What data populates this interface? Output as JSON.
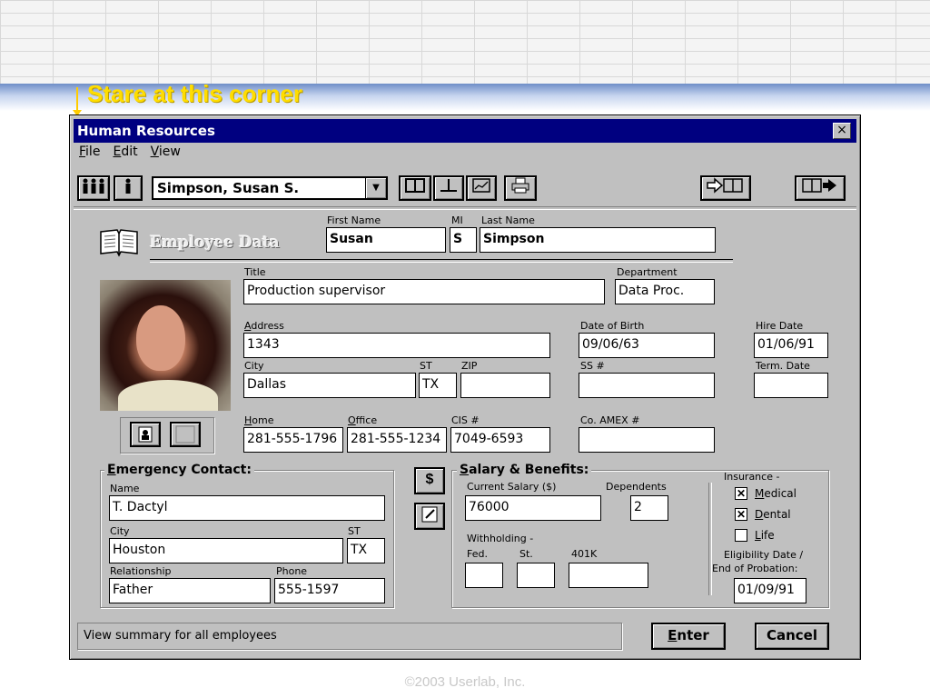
{
  "slide": {
    "note": "Stare at this corner",
    "footer": "©2003 Userlab, Inc."
  },
  "window": {
    "title": "Human Resources",
    "close_glyph": "×"
  },
  "menu": [
    "File",
    "Edit",
    "View"
  ],
  "toolbar": {
    "employee_select": "Simpson, Susan S."
  },
  "header": {
    "title": "Employee Data"
  },
  "employee": {
    "first_name_label": "First Name",
    "first_name": "Susan",
    "mi_label": "MI",
    "mi": "S",
    "last_name_label": "Last Name",
    "last_name": "Simpson",
    "title_label": "Title",
    "title": "Production supervisor",
    "department_label": "Department",
    "department": "Data Proc.",
    "address_label": "Address",
    "address": "1343",
    "dob_label": "Date of Birth",
    "dob": "09/06/63",
    "hire_date_label": "Hire Date",
    "hire_date": "01/06/91",
    "city_label": "City",
    "city": "Dallas",
    "st_label": "ST",
    "st": "TX",
    "zip_label": "ZIP",
    "zip": "",
    "ss_label": "SS #",
    "ss": "",
    "term_date_label": "Term. Date",
    "term_date": "",
    "home_label": "Home",
    "home": "281-555-1796",
    "office_label": "Office",
    "office": "281-555-1234",
    "cis_label": "CIS #",
    "cis": "7049-6593",
    "amex_label": "Co. AMEX #",
    "amex": ""
  },
  "emergency": {
    "group_title": "Emergency Contact:",
    "name_label": "Name",
    "name": "T. Dactyl",
    "city_label": "City",
    "city": "Houston",
    "st_label": "ST",
    "st": "TX",
    "relationship_label": "Relationship",
    "relationship": "Father",
    "phone_label": "Phone",
    "phone": "555-1597"
  },
  "salary": {
    "group_title": "Salary & Benefits:",
    "current_label": "Current Salary ($)",
    "current": "76000",
    "dependents_label": "Dependents",
    "dependents": "2",
    "withholding_label": "Withholding -",
    "fed_label": "Fed.",
    "fed": "",
    "st_label": "St.",
    "st": "",
    "k401_label": "401K",
    "k401": "",
    "insurance_label": "Insurance -",
    "medical_label": "Medical",
    "medical_checked": true,
    "dental_label": "Dental",
    "dental_checked": true,
    "life_label": "Life",
    "life_checked": false,
    "eligibility_label_1": "Eligibility Date /",
    "eligibility_label_2": "End of Probation:",
    "eligibility": "01/09/91",
    "dollar_glyph": "$"
  },
  "footer": {
    "status": "View summary for all employees",
    "enter_label": "Enter",
    "cancel_label": "Cancel"
  }
}
